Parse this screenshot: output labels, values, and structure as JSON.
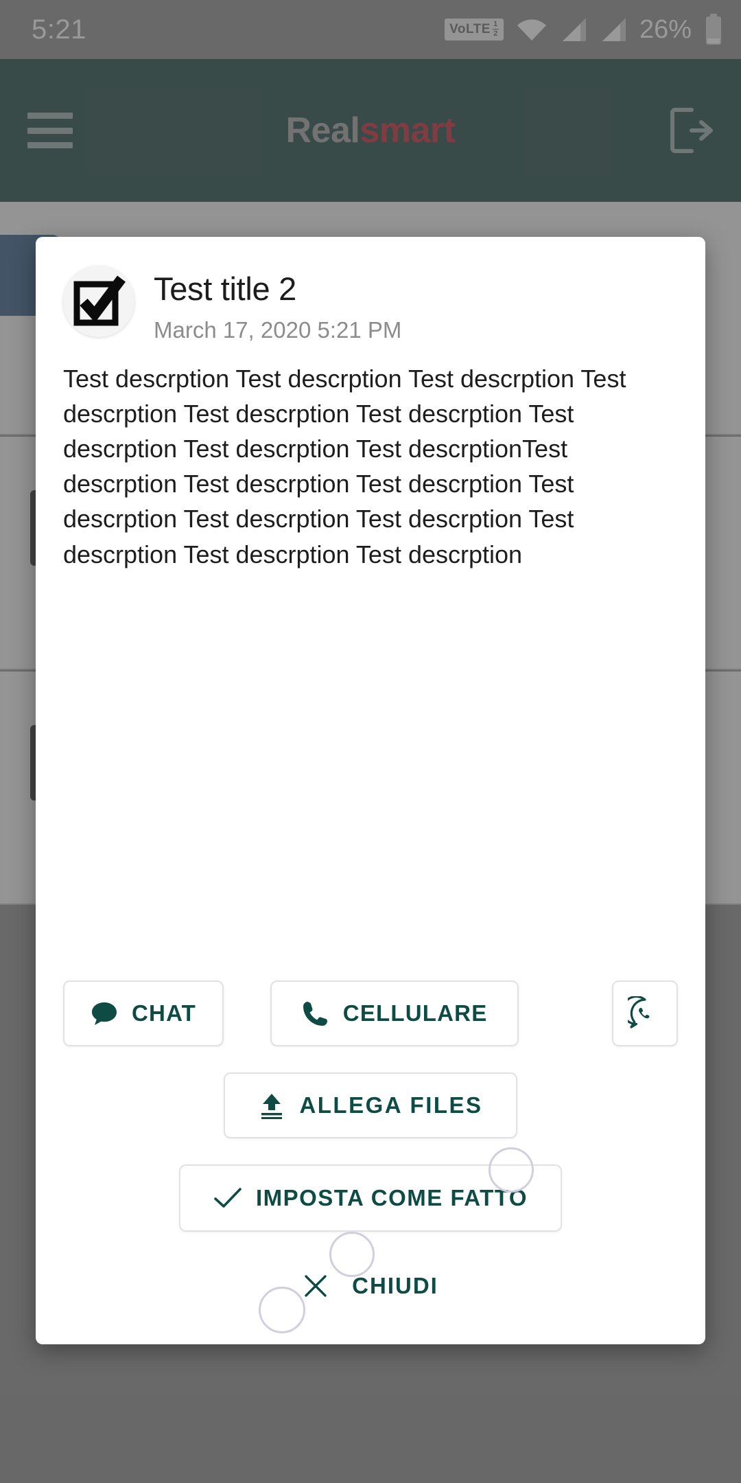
{
  "status_bar": {
    "clock": "5:21",
    "volte_label": "VoLTE",
    "volte_sub_top": "1",
    "volte_sub_bottom": "2",
    "wifi_icon": "wifi-icon",
    "signal1_icon": "signal-bars-icon",
    "signal2_icon": "signal-bars-icon",
    "battery_percent": "26%",
    "battery_icon": "battery-icon"
  },
  "app_bar": {
    "menu_icon": "hamburger-menu-icon",
    "brand_first": "Real",
    "brand_second": "smart",
    "logout_icon": "logout-icon"
  },
  "dialog": {
    "task_icon": "checkbox-checked-icon",
    "title": "Test title 2",
    "date": "March 17, 2020 5:21 PM",
    "description": "Test descrption Test descrption Test descrption Test descrption Test descrption Test descrption Test descrption Test descrption Test descrptionTest descrption Test descrption Test descrption Test descrption Test descrption Test descrption Test descrption Test descrption Test descrption",
    "actions": {
      "chat": {
        "label": "CHAT",
        "icon": "chat-bubble-icon"
      },
      "cellulare": {
        "label": "CELLULARE",
        "icon": "phone-icon"
      },
      "whatsapp": {
        "label": "",
        "icon": "whatsapp-icon"
      },
      "allega": {
        "label": "ALLEGA  FILES",
        "icon": "upload-icon"
      },
      "fatto": {
        "label": "IMPOSTA COME FATTO",
        "icon": "check-icon"
      },
      "chiudi": {
        "label": "CHIUDI",
        "icon": "close-x-icon"
      }
    }
  },
  "colors": {
    "app_bar": "#05332F",
    "brand_accent": "#C10D1B",
    "action_text": "#0D4B44",
    "scrim": "#808080",
    "bg_accent_card": "#1B4A77"
  }
}
